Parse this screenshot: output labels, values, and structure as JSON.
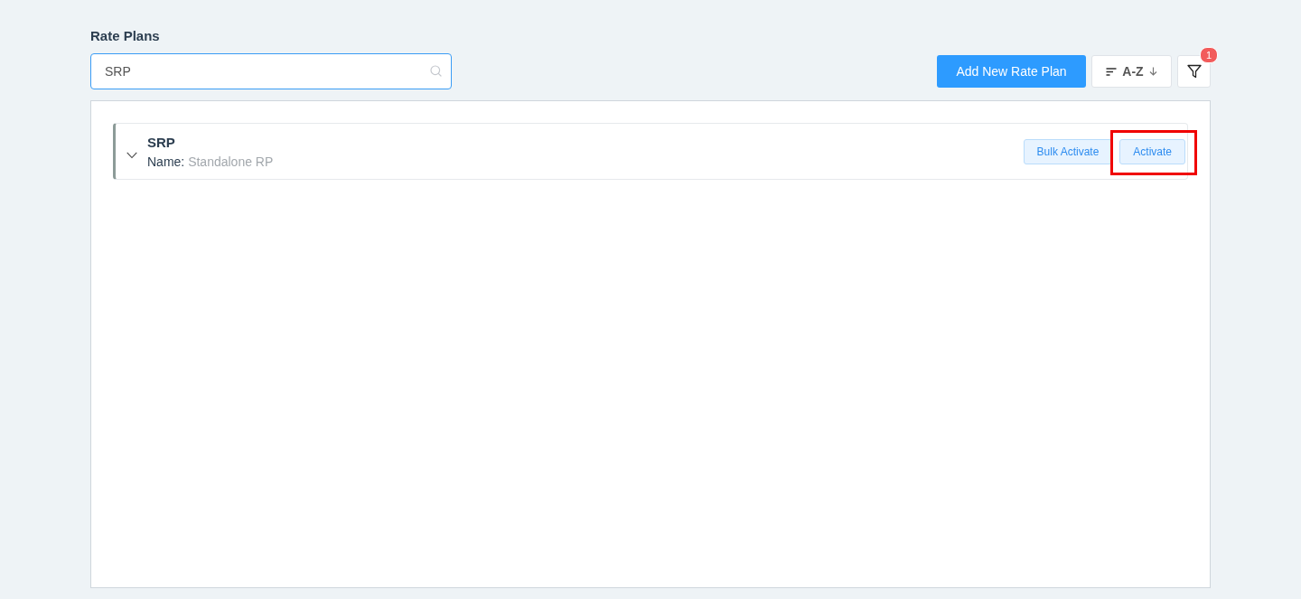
{
  "page": {
    "title": "Rate Plans"
  },
  "search": {
    "value": "SRP"
  },
  "toolbar": {
    "add_button": "Add New Rate Plan",
    "sort": {
      "label": "A-Z"
    },
    "filter": {
      "badge": "1"
    }
  },
  "rate_plans": [
    {
      "code": "SRP",
      "name_label": "Name:",
      "name": "Standalone RP",
      "expanded": false,
      "actions": [
        {
          "label": "Bulk Activate",
          "highlighted": false
        },
        {
          "label": "Activate",
          "highlighted": true
        }
      ]
    }
  ]
}
